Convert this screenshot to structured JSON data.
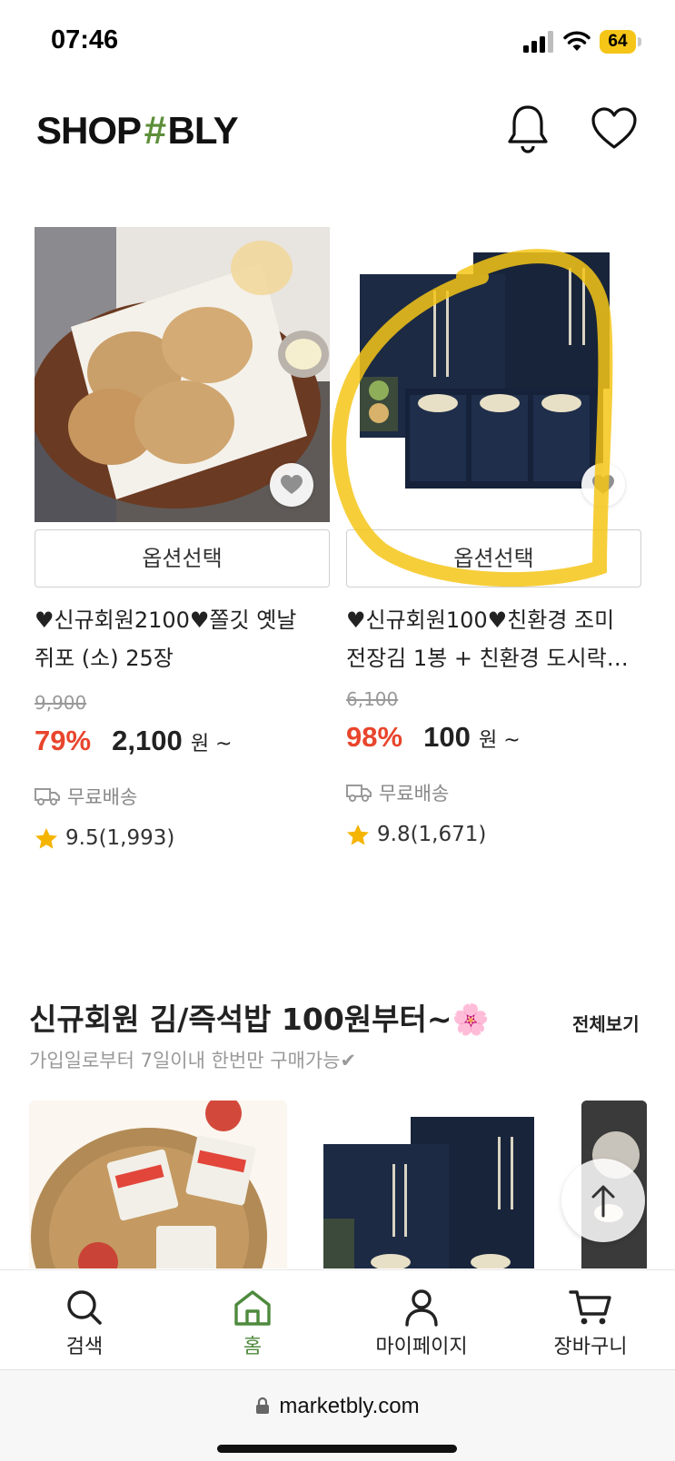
{
  "status_bar": {
    "time": "07:46",
    "battery": "64"
  },
  "header": {
    "logo_left": "SHOP",
    "logo_mark": "#",
    "logo_right": "BLY"
  },
  "products": [
    {
      "option_label": "옵션선택",
      "title_line1": "♥신규회원2100♥쫄깃 옛날",
      "title_line2": "쥐포 (소) 25장",
      "original_price": "9,900",
      "discount": "79%",
      "price": "2,100",
      "currency": "원 ~",
      "shipping": "무료배송",
      "rating": "9.5(1,993)"
    },
    {
      "option_label": "옵션선택",
      "title_line1": "♥신규회원100♥친환경 조미",
      "title_line2": "전장김 1봉 + 친환경 도시락…",
      "original_price": "6,100",
      "discount": "98%",
      "price": "100",
      "currency": "원 ~",
      "shipping": "무료배송",
      "rating": "9.8(1,671)"
    }
  ],
  "section": {
    "title": "신규회원 김/즉석밥 100원부터~🌸",
    "more": "전체보기",
    "subtitle": "가입일로부터 7일이내 한번만 구매가능✔"
  },
  "bottom_nav": {
    "items": [
      {
        "label": "검색",
        "icon": "search-icon"
      },
      {
        "label": "홈",
        "icon": "home-icon"
      },
      {
        "label": "마이페이지",
        "icon": "person-icon"
      },
      {
        "label": "장바구니",
        "icon": "cart-icon"
      }
    ],
    "active": "홈"
  },
  "browser": {
    "url": "marketbly.com"
  },
  "colors": {
    "brand_green": "#4e8a3d",
    "discount_red": "#e8452c",
    "highlight_yellow": "#f5c518"
  }
}
